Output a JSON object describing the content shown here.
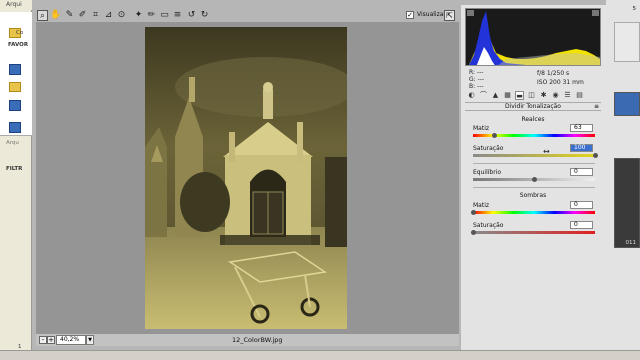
{
  "background_left": {
    "menu_label": "Arqui",
    "favorites_label": "FAVOR",
    "folder_label": "Co",
    "sub_label": "Arqu",
    "filter_label": "FILTR",
    "bottom_number": "1"
  },
  "background_right": {
    "label_top": "5",
    "label_bottom": "011"
  },
  "toolbar": {
    "preview_label": "Visualizar",
    "preview_checked": "✓"
  },
  "canvas": {
    "filename": "12_ColorBW.jpg"
  },
  "statusbar": {
    "zoom_value": "40,2%",
    "zoom_minus": "-",
    "zoom_plus": "+"
  },
  "panel": {
    "rgb": {
      "r": "R:  ---",
      "g": "G:  ---",
      "b": "B:  ---"
    },
    "camera": {
      "line1": "f/8      1/250 s",
      "line2": "ISO 200    31 mm"
    },
    "title": "Dividir Tonalização",
    "highlights": {
      "title": "Realces",
      "hue_label": "Matiz",
      "hue_value": "63",
      "saturation_label": "Saturação",
      "saturation_value": "100"
    },
    "balance": {
      "label": "Equilíbrio",
      "value": "0"
    },
    "shadows": {
      "title": "Sombras",
      "hue_label": "Matiz",
      "hue_value": "0",
      "saturation_label": "Saturação",
      "saturation_value": "0"
    },
    "slider_levels": {
      "highlights_hue": 0.175,
      "highlights_saturation": 1.0,
      "balance": 0.5,
      "shadows_hue": 0.0,
      "shadows_saturation": 0.0
    }
  },
  "colors": {
    "dialog_bg": "#b6b6b6",
    "canvas_bg": "#959595",
    "panel_bg": "#e3e3e3",
    "sepia_tint": "#d8cf7a"
  }
}
